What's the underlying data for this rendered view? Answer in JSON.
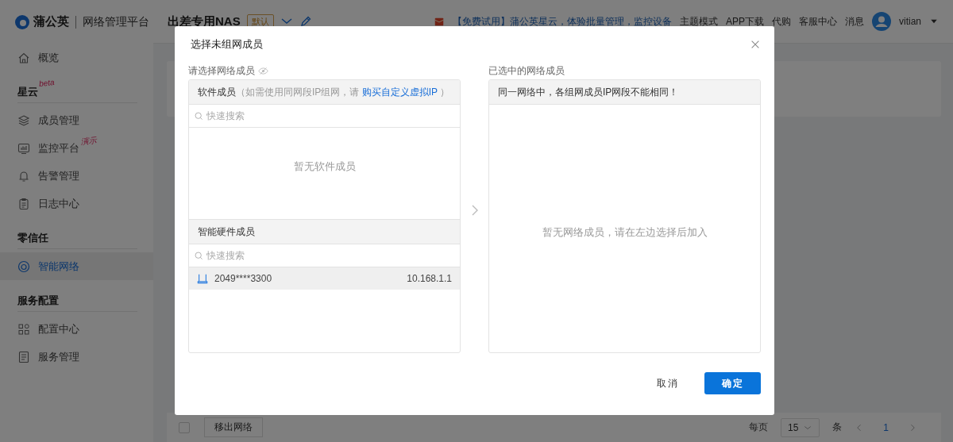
{
  "app": {
    "logo_text": "蒲公英",
    "platform": "网络管理平台"
  },
  "header": {
    "network_name": "出差专用NAS",
    "default_badge": "默认",
    "notice": "【免费试用】蒲公英星云，体验批量管理，监控设备",
    "links": [
      "主题模式",
      "APP下载",
      "代购",
      "客服中心",
      "消息"
    ],
    "username": "vitian"
  },
  "sidebar": {
    "items": [
      {
        "kind": "item",
        "label": "概览",
        "selected": false
      },
      {
        "kind": "section",
        "label": "星云",
        "tag": "beta"
      },
      {
        "kind": "item",
        "label": "成员管理",
        "selected": false
      },
      {
        "kind": "item",
        "label": "监控平台",
        "tag": "演示",
        "selected": false
      },
      {
        "kind": "item",
        "label": "告警管理",
        "selected": false
      },
      {
        "kind": "item",
        "label": "日志中心",
        "selected": false
      },
      {
        "kind": "section",
        "label": "零信任"
      },
      {
        "kind": "item",
        "label": "智能网络",
        "selected": true
      },
      {
        "kind": "section",
        "label": "服务配置"
      },
      {
        "kind": "item",
        "label": "配置中心",
        "selected": false
      },
      {
        "kind": "item",
        "label": "服务管理",
        "selected": false
      }
    ]
  },
  "footer_bar": {
    "select_all_checked": false,
    "remove_button": "移出网络",
    "per_page_label": "每页",
    "page_size": "15",
    "unit": "条",
    "pages": [
      {
        "label": "1",
        "selected": true
      }
    ]
  },
  "dialog": {
    "title": "选择未组网成员",
    "left": {
      "label": "请选择网络成员",
      "software": {
        "title": "软件成员",
        "hint_before": "（如需使用同网段IP组网，请 ",
        "link": "购买自定义虚拟IP",
        "hint_after": " ）",
        "search_placeholder": "快速搜索",
        "empty_text": "暂无软件成员"
      },
      "hardware": {
        "title": "智能硬件成员",
        "search_placeholder": "快速搜索",
        "members": [
          {
            "name": "2049****3300",
            "ip": "10.168.1.1",
            "selected": true
          }
        ]
      }
    },
    "right": {
      "label": "已选中的网络成员",
      "notice": "同一网络中，各组网成员IP网段不能相同！",
      "empty_text": "暂无网络成员，请在左边选择后加入"
    },
    "cancel_button": "取消",
    "confirm_button": "确定"
  }
}
